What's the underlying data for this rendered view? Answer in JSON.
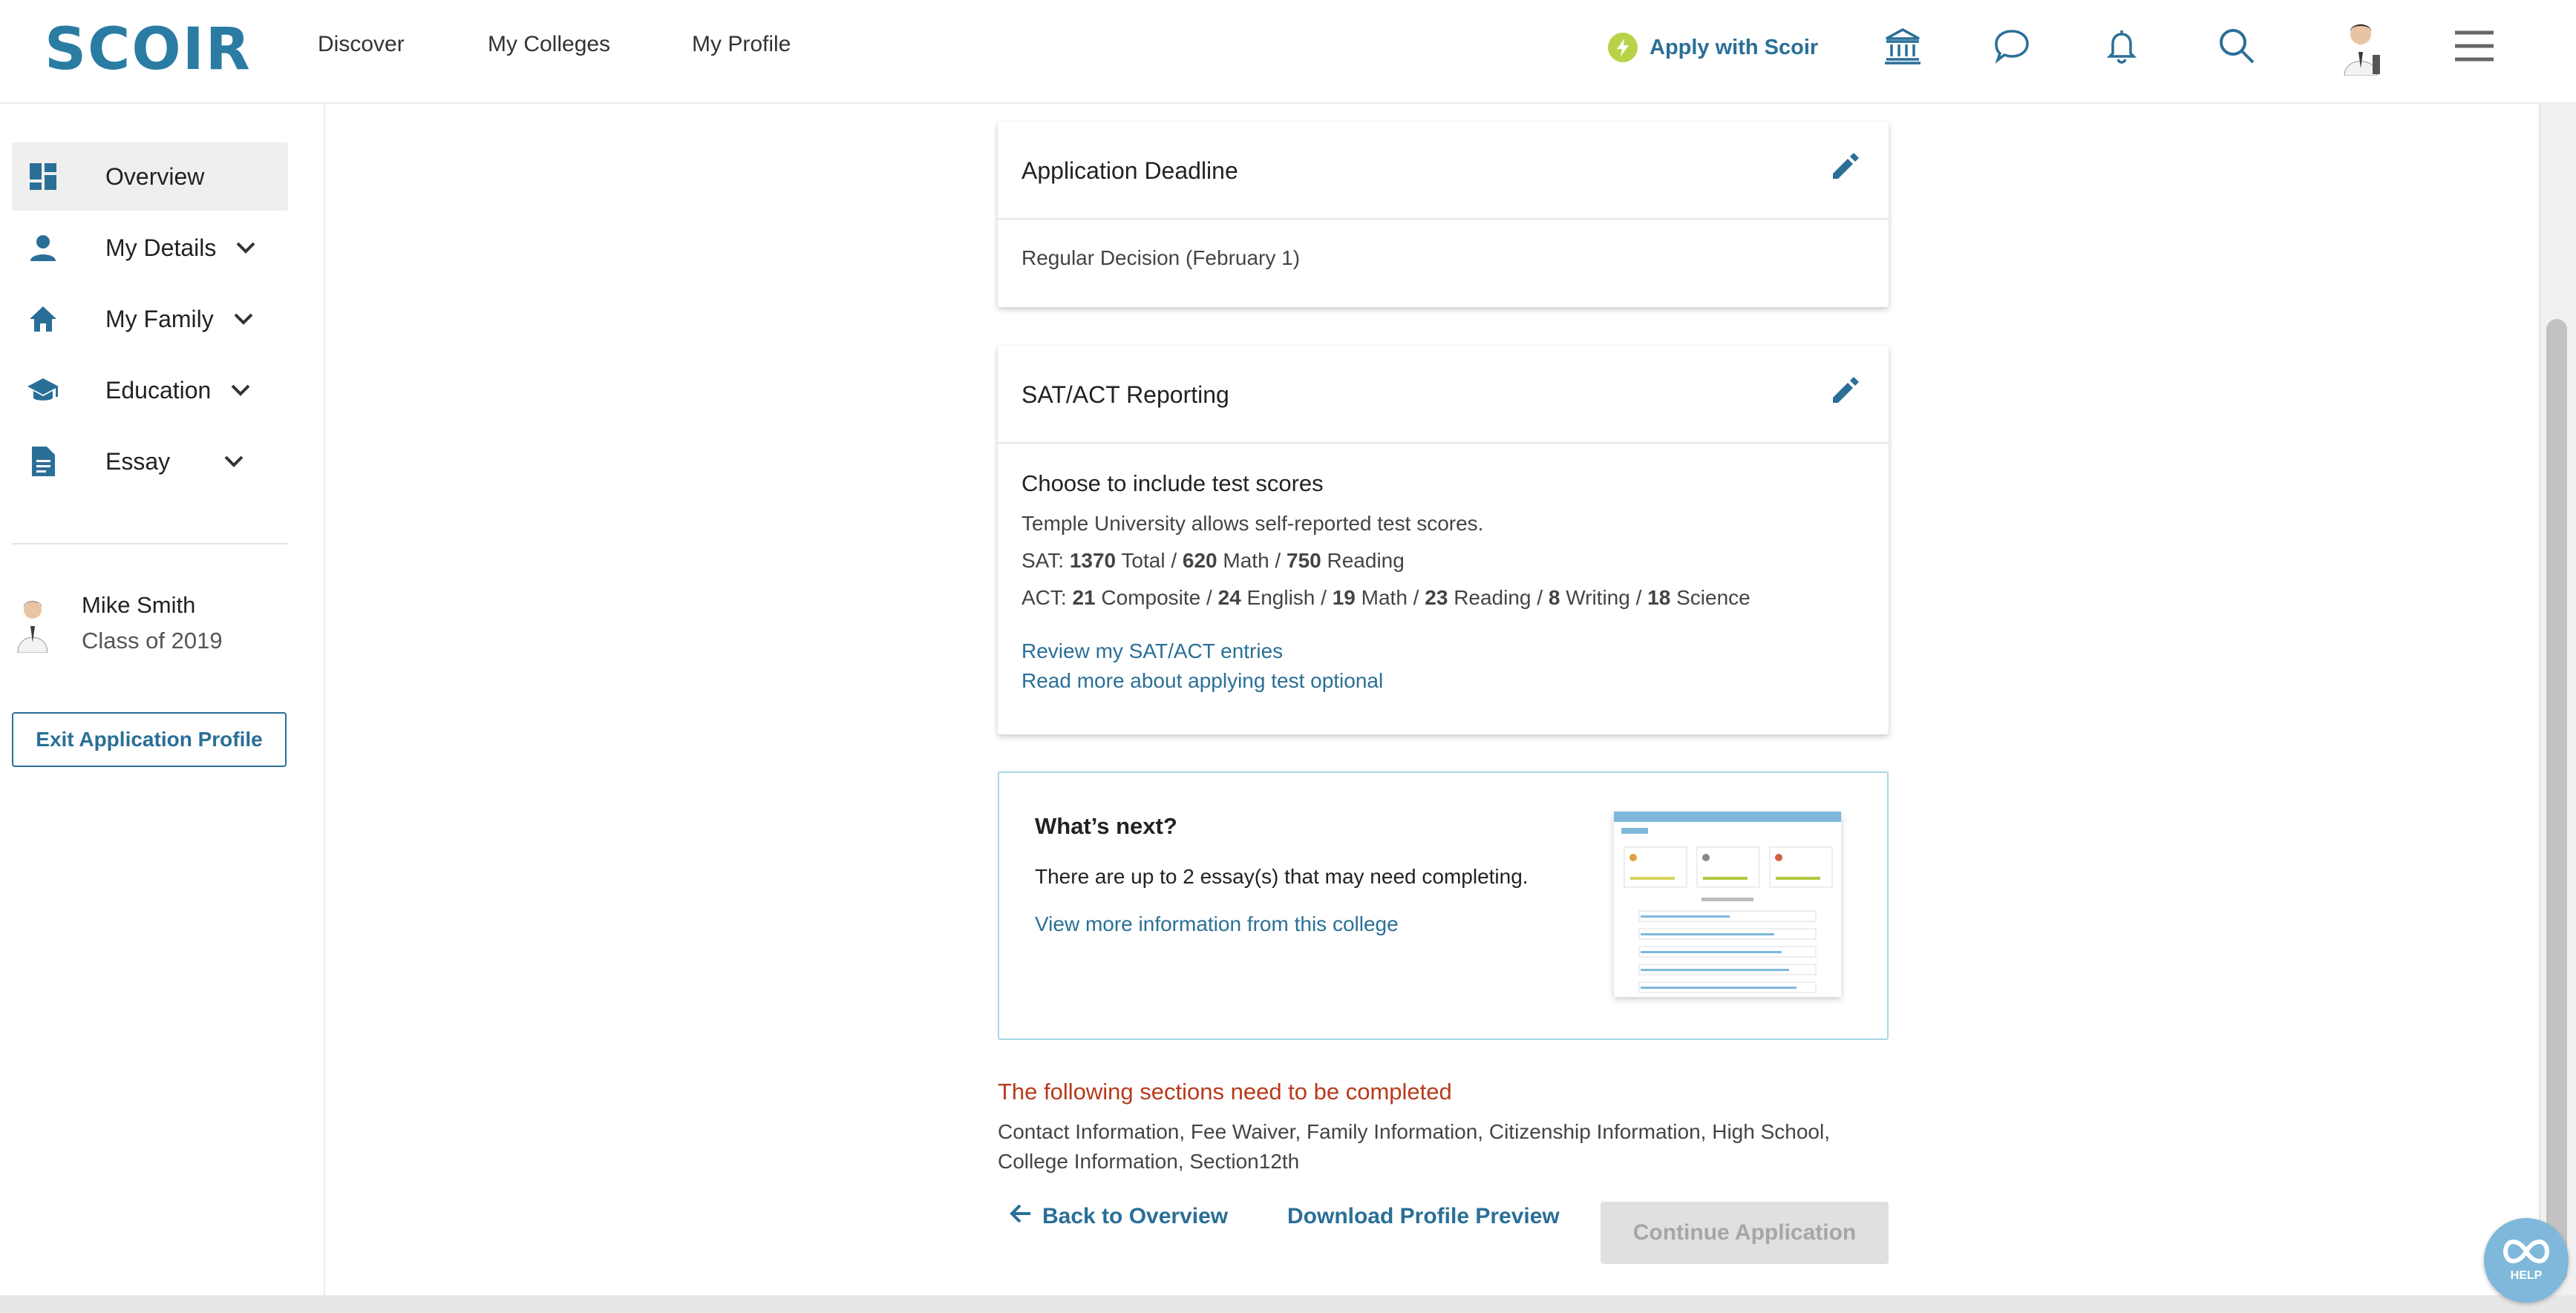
{
  "header": {
    "logo": "SCOIR",
    "nav": [
      {
        "label": "Discover"
      },
      {
        "label": "My Colleges"
      },
      {
        "label": "My Profile"
      }
    ],
    "apply_label": "Apply with Scoir"
  },
  "sidebar": {
    "items": [
      {
        "label": "Overview",
        "active": true
      },
      {
        "label": "My Details"
      },
      {
        "label": "My Family"
      },
      {
        "label": "Education"
      },
      {
        "label": "Essay"
      }
    ],
    "user": {
      "name": "Mike Smith",
      "class": "Class of 2019"
    },
    "exit_label": "Exit Application Profile"
  },
  "deadline_card": {
    "title": "Application Deadline",
    "value": "Regular Decision (February 1)"
  },
  "test_card": {
    "title": "SAT/ACT Reporting",
    "heading": "Choose to include test scores",
    "note": "Temple University allows self-reported test scores.",
    "sat": {
      "prefix": "SAT:",
      "total": "1370",
      "total_label": "Total /",
      "math": "620",
      "math_label": "Math /",
      "reading": "750",
      "reading_label": "Reading"
    },
    "act": {
      "prefix": "ACT:",
      "composite": "21",
      "composite_label": "Composite /",
      "english": "24",
      "english_label": "English /",
      "math": "19",
      "math_label": "Math /",
      "reading": "23",
      "reading_label": "Reading /",
      "writing": "8",
      "writing_label": "Writing /",
      "science": "18",
      "science_label": "Science"
    },
    "link_review": "Review my SAT/ACT entries",
    "link_optional": "Read more about applying test optional"
  },
  "next_card": {
    "title": "What’s next?",
    "text": "There are up to 2 essay(s) that may need completing.",
    "link": "View more information from this college"
  },
  "incomplete": {
    "title": "The following sections need to be completed",
    "list": "Contact Information, Fee Waiver, Family Information, Citizenship Information, High School, College Information, Section12th"
  },
  "footer": {
    "back_label": "Back to Overview",
    "download_label": "Download Profile Preview",
    "continue_label": "Continue Application"
  },
  "help_label": "HELP",
  "colors": {
    "brand": "#2a7ca3",
    "link": "#2a6f97",
    "warning": "#b83a1b",
    "apply_badge": "#b8d348"
  }
}
